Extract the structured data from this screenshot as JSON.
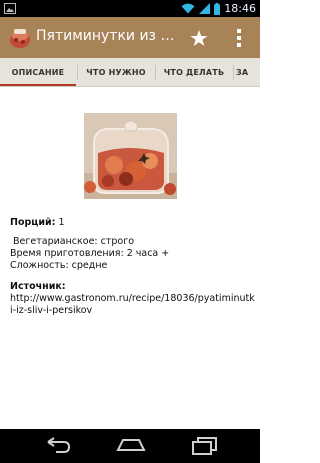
{
  "status_bar": {
    "time": "18:46",
    "icons": [
      "image-icon",
      "wifi-icon",
      "signal-icon",
      "battery-icon"
    ]
  },
  "action_bar": {
    "title": "Пятиминутки из сли...",
    "icons": [
      "app-icon",
      "star-icon",
      "overflow-menu-icon"
    ]
  },
  "tabs": [
    {
      "label": "ОПИСАНИЕ",
      "active": true
    },
    {
      "label": "ЧТО НУЖНО",
      "active": false
    },
    {
      "label": "ЧТО ДЕЛАТЬ",
      "active": false
    },
    {
      "label": "ЗА",
      "active": false
    }
  ],
  "recipe": {
    "portions_label": "Порций:",
    "portions_value": "1",
    "vegetarian": " Вегетарианское: строго",
    "cook_time": "Время приготовления: 2 часа +",
    "difficulty": "Сложность: средне",
    "source_label": "Источник:",
    "source_url": "http://www.gastronom.ru/recipe/18036/pyatiminutki-iz-sliv-i-persikov"
  },
  "nav_bar": {
    "icons": [
      "back-icon",
      "home-icon",
      "recent-apps-icon"
    ]
  },
  "colors": {
    "action_bar": "#a88358",
    "tab_bar": "#e6e3dc",
    "tab_indicator": "#b33a22",
    "status_accent": "#33b5e5"
  }
}
